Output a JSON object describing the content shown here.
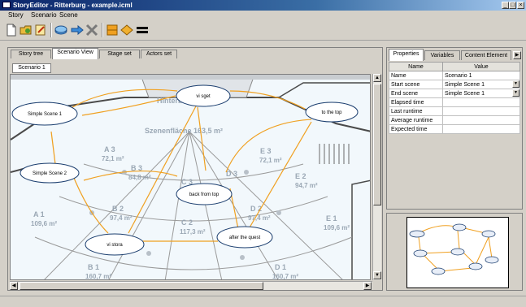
{
  "window": {
    "title": "StoryEditor - Ritterburg - example.icml",
    "controls": {
      "minimize": "_",
      "maximize": "□",
      "close": "×"
    }
  },
  "menu": {
    "items": [
      "Story",
      "Scenario",
      "Scene"
    ]
  },
  "toolbar": {
    "icons": [
      "new-file-icon",
      "open-folder-icon",
      "edit-icon",
      "disk-icon",
      "arrow-right-icon",
      "delete-icon",
      "orange-square-icon",
      "orange-diamond-icon",
      "equals-icon"
    ]
  },
  "editor": {
    "tabs": [
      "Story tree",
      "Scenario View",
      "Stage set",
      "Actors set"
    ],
    "active_tab": "Scenario View",
    "subtab": "Scenario 1",
    "map": {
      "room_labels": [
        "Hinterb",
        "Szenenfläche 163,5 m²",
        "A 3",
        "72,1 m²",
        "B 3",
        "84,8 m²",
        "C 3",
        "D 3",
        "E 3",
        "72,1 m²",
        "E 2",
        "94,7 m²",
        "A 1",
        "109,6 m²",
        "B 2",
        "97,4 m²",
        "C 2",
        "117,3 m²",
        "D 2",
        "97,4 m²",
        "E 1",
        "109,6 m²",
        "B 1",
        "160,7 m²",
        "D 1",
        "160,7 m²"
      ]
    },
    "scenes": [
      {
        "label": "Simple Scene 1"
      },
      {
        "label": "vi sget"
      },
      {
        "label": "to the top"
      },
      {
        "label": "Simple Scene 2"
      },
      {
        "label": "back from top"
      },
      {
        "label": "vi stora"
      },
      {
        "label": "after the quest"
      }
    ]
  },
  "properties": {
    "tabs": [
      "Properties",
      "Variables",
      "Content Element"
    ],
    "headers": [
      "Name",
      "Value"
    ],
    "rows": [
      {
        "name": "Name",
        "value": "Scenario 1"
      },
      {
        "name": "Start scene",
        "value": "Simple Scene 1",
        "dropdown": true
      },
      {
        "name": "End scene",
        "value": "Simple Scene 1",
        "dropdown": true
      },
      {
        "name": "Elapsed time",
        "value": ""
      },
      {
        "name": "Last runtime",
        "value": ""
      },
      {
        "name": "Average runtime",
        "value": ""
      },
      {
        "name": "Expected time",
        "value": ""
      }
    ]
  },
  "colors": {
    "title_start": "#0a246a",
    "title_end": "#a6caf0",
    "node_border": "#1a3d6e",
    "edge": "#f0a020",
    "floor": "#f2f8fc"
  }
}
